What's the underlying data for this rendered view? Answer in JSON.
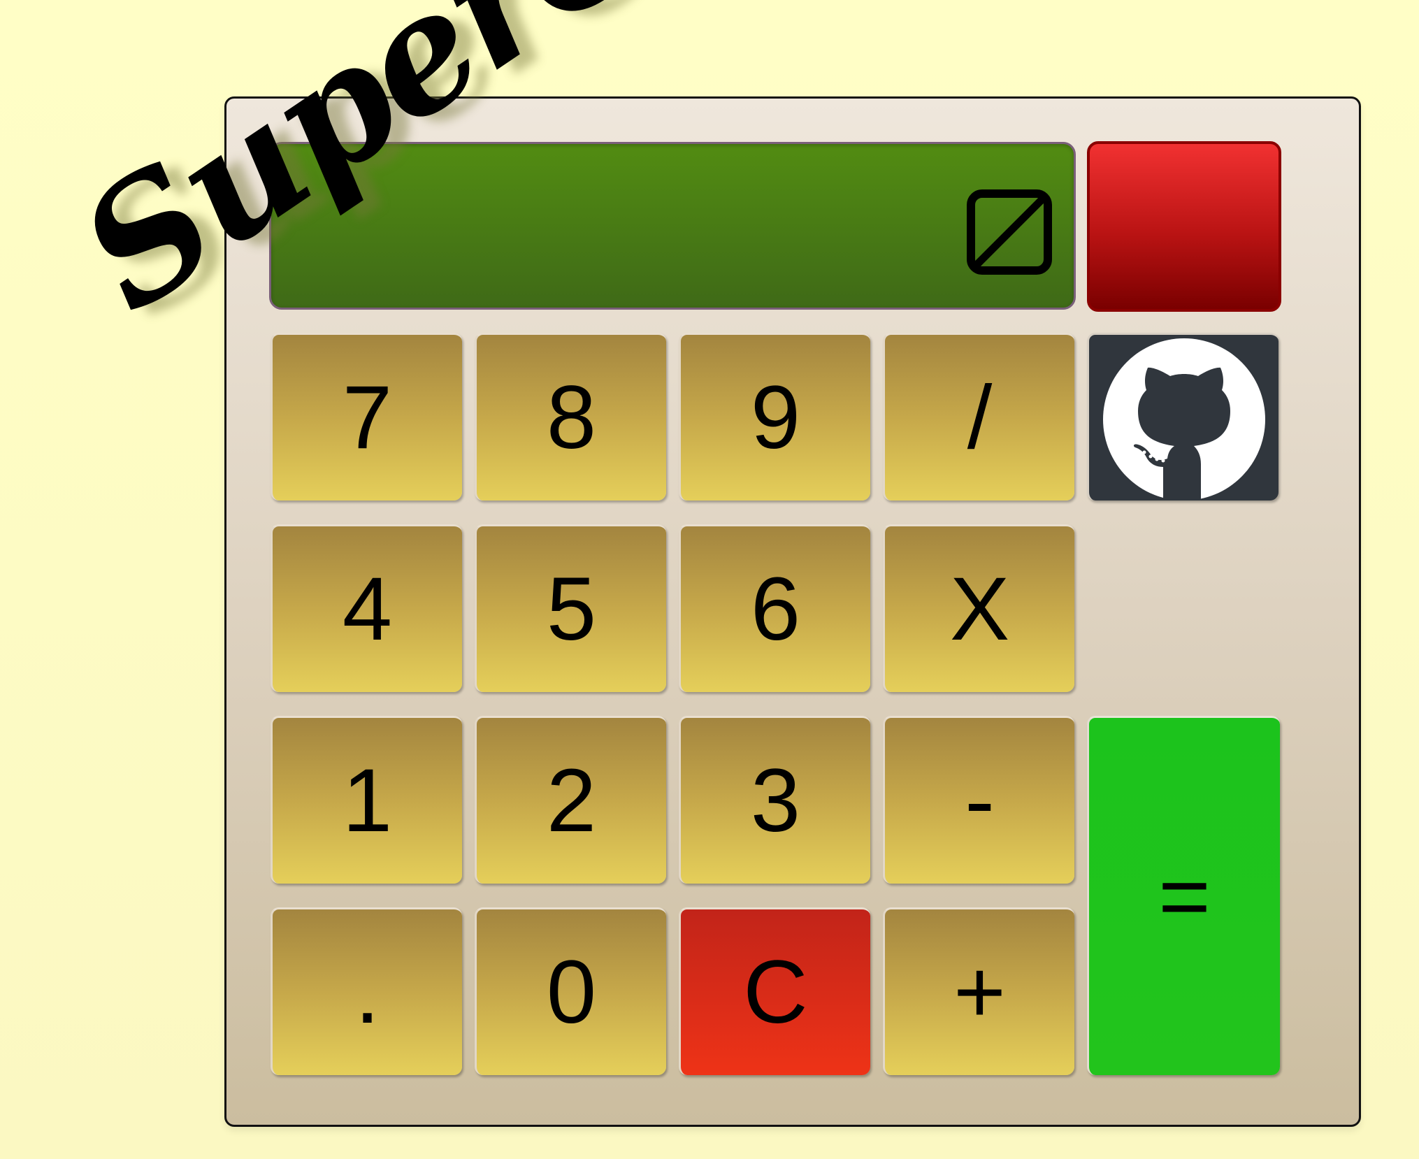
{
  "app": {
    "brand": "SuperCalc"
  },
  "display": {
    "value": "",
    "empty_icon": "square-slash-icon"
  },
  "buttons": {
    "power": {
      "label": "",
      "color": "#d91f1f"
    },
    "github": {
      "icon": "github-icon"
    },
    "equals": {
      "label": "=",
      "color": "#1ec31c"
    },
    "clear": {
      "label": "C",
      "color": "#e13017"
    }
  },
  "keypad": {
    "rows": [
      [
        "7",
        "8",
        "9",
        "/"
      ],
      [
        "4",
        "5",
        "6",
        "X"
      ],
      [
        "1",
        "2",
        "3",
        "-"
      ],
      [
        ".",
        "0",
        "C",
        "+"
      ]
    ]
  },
  "colors": {
    "page_background": "#fdfbc4",
    "calculator_background": "#e6dccd",
    "display_background": "#4a7d14",
    "key_background": "#d2b450"
  }
}
